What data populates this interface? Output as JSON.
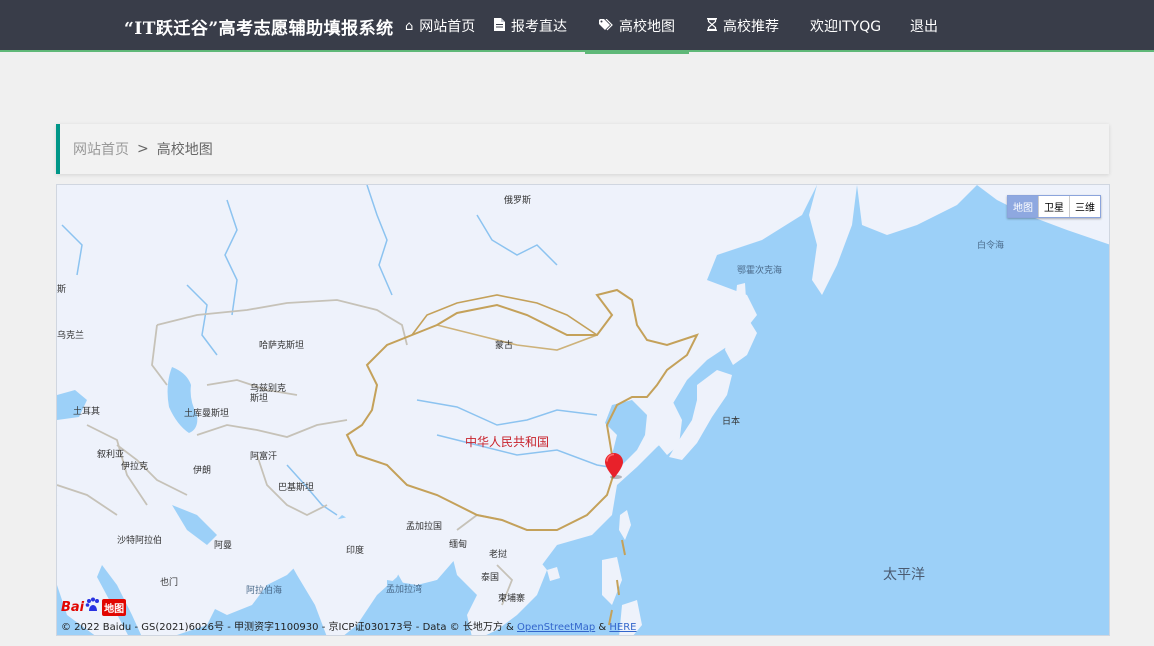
{
  "brand": {
    "title": "“IT跃迁谷”高考志愿辅助填报系统"
  },
  "nav": {
    "items": [
      {
        "key": "home",
        "label": "网站首页",
        "icon": "home-icon"
      },
      {
        "key": "report",
        "label": "报考直达",
        "icon": "document-icon"
      },
      {
        "key": "map",
        "label": "高校地图",
        "icon": "tag-icon"
      },
      {
        "key": "recommend",
        "label": "高校推荐",
        "icon": "hourglass-icon"
      }
    ],
    "welcome": "欢迎ITYQG",
    "logout": "退出",
    "active": "map",
    "accent_color": "#5FB878",
    "bg_color": "#393d49"
  },
  "breadcrumb": {
    "home": "网站首页",
    "separator": ">",
    "current": "高校地图",
    "accent_color": "#009688"
  },
  "map": {
    "type_buttons": [
      "地图",
      "卫星",
      "三维"
    ],
    "active_type": "地图",
    "labels": {
      "russia": "俄罗斯",
      "kazakhstan": "哈萨克斯坦",
      "mongolia": "蒙古",
      "uzbekistan": "乌兹别克\n斯坦",
      "turkmenistan": "土库曼斯坦",
      "turkey": "土耳其",
      "iraq": "叙利亚",
      "iraq2": "伊拉克",
      "iran": "伊朗",
      "afghanistan": "阿富汗",
      "pakistan": "巴基斯坦",
      "china": "中华人民共和国",
      "japan": "日本",
      "india": "印度",
      "bangladesh": "孟加拉国",
      "myanmar": "缅甸",
      "laos": "老挝",
      "thailand": "泰国",
      "cambodia": "柬埔寨",
      "saudi": "沙特阿拉伯",
      "oman": "阿曼",
      "yemen": "也门",
      "arabian_sea": "阿拉伯海",
      "bay_of_bengal": "孟加拉湾",
      "pacific": "太平洋",
      "okhotsk": "鄂霍次克海",
      "bering": "白令海",
      "ukraine": "乌克兰",
      "west_edge": "斯"
    },
    "logo": {
      "bai": "Bai",
      "du": "du",
      "ditu": "地图"
    },
    "copyright": {
      "text": "© 2022 Baidu - GS(2021)6026号 - 甲测资字1100930 - 京ICP证030173号 - Data © 长地万方 &",
      "osm": "OpenStreetMap",
      "amp": "&",
      "here": "HERE"
    }
  }
}
